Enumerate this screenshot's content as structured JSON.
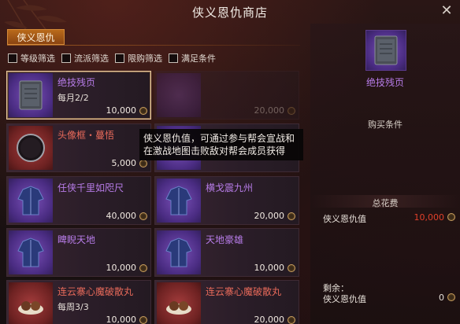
{
  "window": {
    "title": "侠义恩仇商店"
  },
  "tab": {
    "label": "侠义恩仇"
  },
  "filters": [
    {
      "label": "等级筛选"
    },
    {
      "label": "流派筛选"
    },
    {
      "label": "限购筛选"
    },
    {
      "label": "满足条件"
    }
  ],
  "items": [
    {
      "name": "绝技残页",
      "sub": "每月2/2",
      "price": "10,000",
      "icon": "book-icon",
      "color": "purple",
      "selected": true
    },
    {
      "name": "",
      "sub": "",
      "price": "20,000",
      "icon": "dim-item-icon",
      "color": "purple",
      "dim": true
    },
    {
      "name": "头像框・蔓悟",
      "sub": "",
      "price": "5,000",
      "icon": "frame-icon",
      "color": "red"
    },
    {
      "name": "",
      "sub": "",
      "price": "",
      "icon": "",
      "color": "purple"
    },
    {
      "name": "任侠千里如咫尺",
      "sub": "",
      "price": "40,000",
      "icon": "robe-icon",
      "color": "purple"
    },
    {
      "name": "横戈震九州",
      "sub": "",
      "price": "20,000",
      "icon": "robe-icon",
      "color": "purple"
    },
    {
      "name": "睥睨天地",
      "sub": "",
      "price": "10,000",
      "icon": "robe-icon",
      "color": "purple"
    },
    {
      "name": "天地豪雄",
      "sub": "",
      "price": "10,000",
      "icon": "robe-icon",
      "color": "purple"
    },
    {
      "name": "连云寨心魔破散丸",
      "sub": "每周3/3",
      "price": "10,000",
      "icon": "pill-icon",
      "color": "red"
    },
    {
      "name": "连云寨心魔破散丸",
      "sub": "",
      "price": "20,000",
      "icon": "pill-icon",
      "color": "red"
    }
  ],
  "tooltip": {
    "text": "侠义恩仇值，可通过参与帮会宣战和在激战地图击败敌对帮会成员获得"
  },
  "side": {
    "item_name": "绝技残页",
    "purchase_conditions": "购买条件",
    "total_cost": "总花费",
    "cost_label": "侠义恩仇值",
    "cost_value": "10,000",
    "remaining": "剩余：",
    "remaining_label": "侠义恩仇值",
    "remaining_value": "0"
  },
  "colors": {
    "accent": "#b96a1a",
    "purple_text": "#b77ce8",
    "red_text": "#e86a5a"
  }
}
